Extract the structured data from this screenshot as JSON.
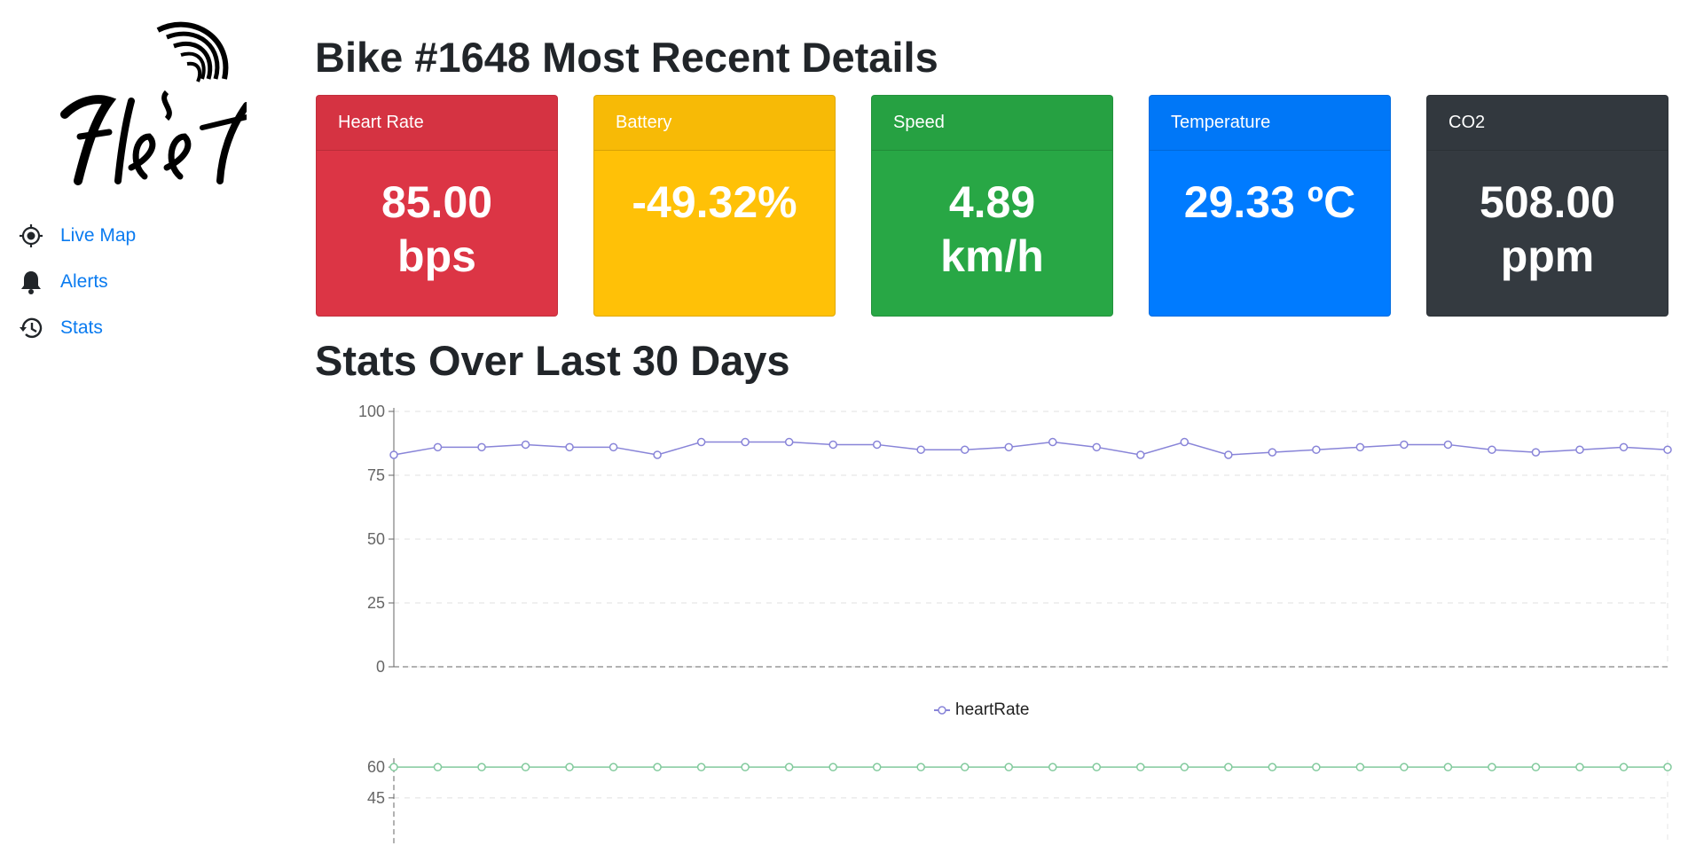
{
  "sidebar": {
    "logo_text": "Fleet",
    "items": [
      {
        "label": "Live Map",
        "icon": "crosshair-icon"
      },
      {
        "label": "Alerts",
        "icon": "bell-icon"
      },
      {
        "label": "Stats",
        "icon": "history-icon"
      }
    ]
  },
  "page_title": "Bike #1648 Most Recent Details",
  "cards": [
    {
      "title": "Heart Rate",
      "value": "85.00",
      "unit": "bps",
      "color": "#dc3545"
    },
    {
      "title": "Battery",
      "value": "-49.32%",
      "unit": "",
      "color": "#ffc107"
    },
    {
      "title": "Speed",
      "value": "4.89",
      "unit": "km/h",
      "color": "#28a745"
    },
    {
      "title": "Temperature",
      "value": "29.33 ºC",
      "unit": "",
      "color": "#007bff"
    },
    {
      "title": "CO2",
      "value": "508.00",
      "unit": "ppm",
      "color": "#343a40"
    }
  ],
  "section_title": "Stats Over Last 30 Days",
  "chart_data": [
    {
      "type": "line",
      "series": [
        {
          "name": "heartRate",
          "color": "#8884d8",
          "values": [
            83,
            86,
            86,
            87,
            86,
            86,
            83,
            88,
            88,
            88,
            87,
            87,
            85,
            85,
            86,
            88,
            86,
            83,
            88,
            83,
            84,
            85,
            86,
            87,
            87,
            85,
            84,
            85,
            86,
            85
          ]
        }
      ],
      "yticks": [
        0,
        25,
        50,
        75,
        100
      ],
      "ylim": [
        0,
        100
      ],
      "grid": true,
      "legend": "bottom"
    },
    {
      "type": "line",
      "series": [
        {
          "name": "",
          "color": "#82ca9d",
          "values": [
            60,
            60,
            60,
            60,
            60,
            60,
            60,
            60,
            60,
            60,
            60,
            60,
            60,
            60,
            60,
            60,
            60,
            60,
            60,
            60,
            60,
            60,
            60,
            60,
            60,
            60,
            60,
            60,
            60,
            60
          ]
        }
      ],
      "yticks": [
        60,
        45
      ],
      "grid": true
    }
  ]
}
